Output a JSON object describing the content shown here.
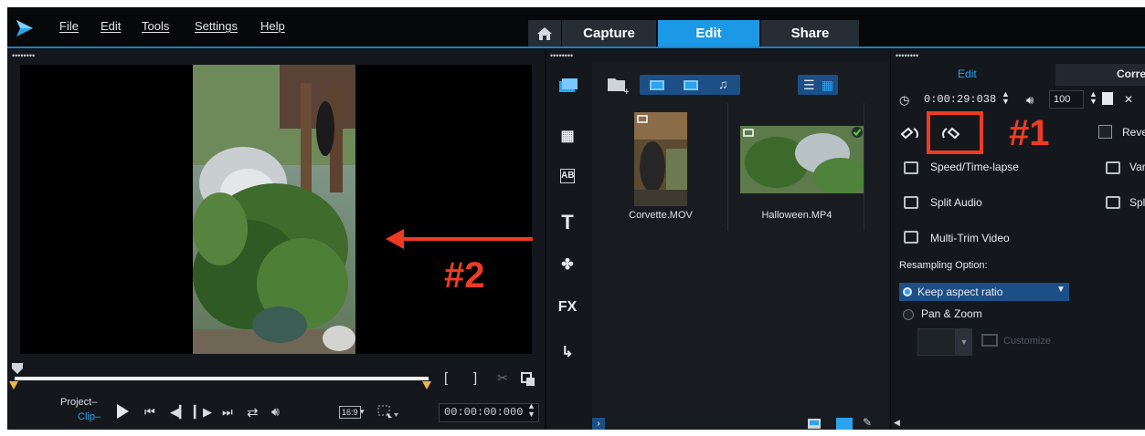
{
  "menu": {
    "file": "File",
    "edit": "Edit",
    "tools": "Tools",
    "settings": "Settings",
    "help": "Help"
  },
  "mode_tabs": {
    "capture": "Capture",
    "edit": "Edit",
    "share": "Share",
    "active": "Edit"
  },
  "player": {
    "project_label": "Project–",
    "clip_label": "Clip–",
    "aspect_label": "16:9",
    "timecode": "00:00:00:000"
  },
  "library": {
    "side_buttons": {
      "fx_label": "FX"
    },
    "clips": [
      {
        "name": "Corvette.MOV"
      },
      {
        "name": "Halloween.MP4"
      }
    ]
  },
  "options": {
    "tab_edit": "Edit",
    "tab_correction": "Corre",
    "duration": "0:00:29:038",
    "volume": "100",
    "reverse_label": "Reve",
    "speed_label": "Speed/Time-lapse",
    "variable_label": "Var",
    "split_audio_label": "Split Audio",
    "split_scene_label": "Spl",
    "multi_trim_label": "Multi-Trim Video",
    "resampling_heading": "Resampling Option:",
    "resampling_selected": "Keep aspect ratio",
    "pan_zoom_label": "Pan & Zoom",
    "customize_label": "Customize"
  },
  "annotations": {
    "one": "#1",
    "two": "#2"
  },
  "colors": {
    "accent": "#1b98e6",
    "annotation": "#f03b24",
    "background": "#0b0d10"
  }
}
